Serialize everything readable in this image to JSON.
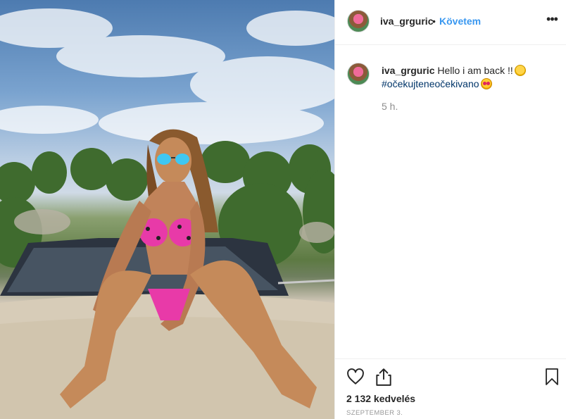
{
  "post": {
    "photo_alt": "Photo by iva_grguric"
  },
  "header": {
    "username": "iva_grguric",
    "separator": "•",
    "follow_label": "Követem",
    "more_icon": "more-options-icon"
  },
  "caption": {
    "username": "iva_grguric",
    "text": "Hello i am back !!",
    "hashtag": "#očekujteneočekivano",
    "emoji_1": "winking-face",
    "emoji_2": "heart-eyes-face",
    "time_ago": "5 h."
  },
  "actions": {
    "like_icon": "heart-icon",
    "share_icon": "share-icon",
    "save_icon": "bookmark-icon",
    "likes_count": "2 132 kedvelés",
    "date": "SZEPTEMBER 3."
  },
  "colors": {
    "link_blue": "#3897f0",
    "hashtag_blue": "#003569",
    "text": "#262626",
    "muted": "#8e8e8e",
    "border": "#efefef"
  }
}
